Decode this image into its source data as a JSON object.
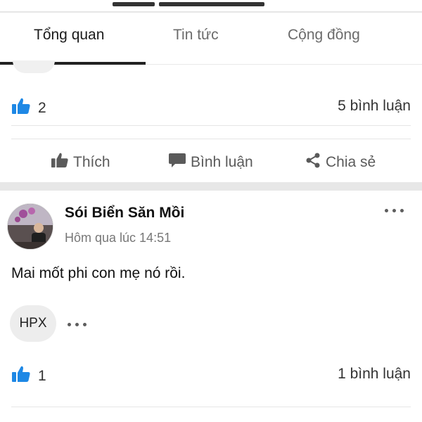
{
  "tabs": [
    {
      "label": "Tổng quan",
      "active": true
    },
    {
      "label": "Tin tức",
      "active": false
    },
    {
      "label": "Cộng đồng",
      "active": false
    }
  ],
  "post1": {
    "like_count": "2",
    "comment_count": "5 bình luận",
    "actions": {
      "like": "Thích",
      "comment": "Bình luận",
      "share": "Chia sẻ"
    }
  },
  "post2": {
    "author": "Sói Biển Săn Mồi",
    "timestamp": "Hôm qua lúc 14:51",
    "body": "Mai mốt phi con mẹ nó rồi.",
    "tag": "HPX",
    "like_count": "1",
    "comment_count": "1 bình luận"
  },
  "colors": {
    "accent_blue": "#1e88e5",
    "text_primary": "#1c1c1c",
    "text_secondary": "#6b6b6b",
    "separator": "#e7e7e7"
  },
  "icons": {
    "like": "thumbs-up-icon",
    "comment": "speech-bubble-icon",
    "share": "share-icon",
    "more": "more-options-icon"
  }
}
